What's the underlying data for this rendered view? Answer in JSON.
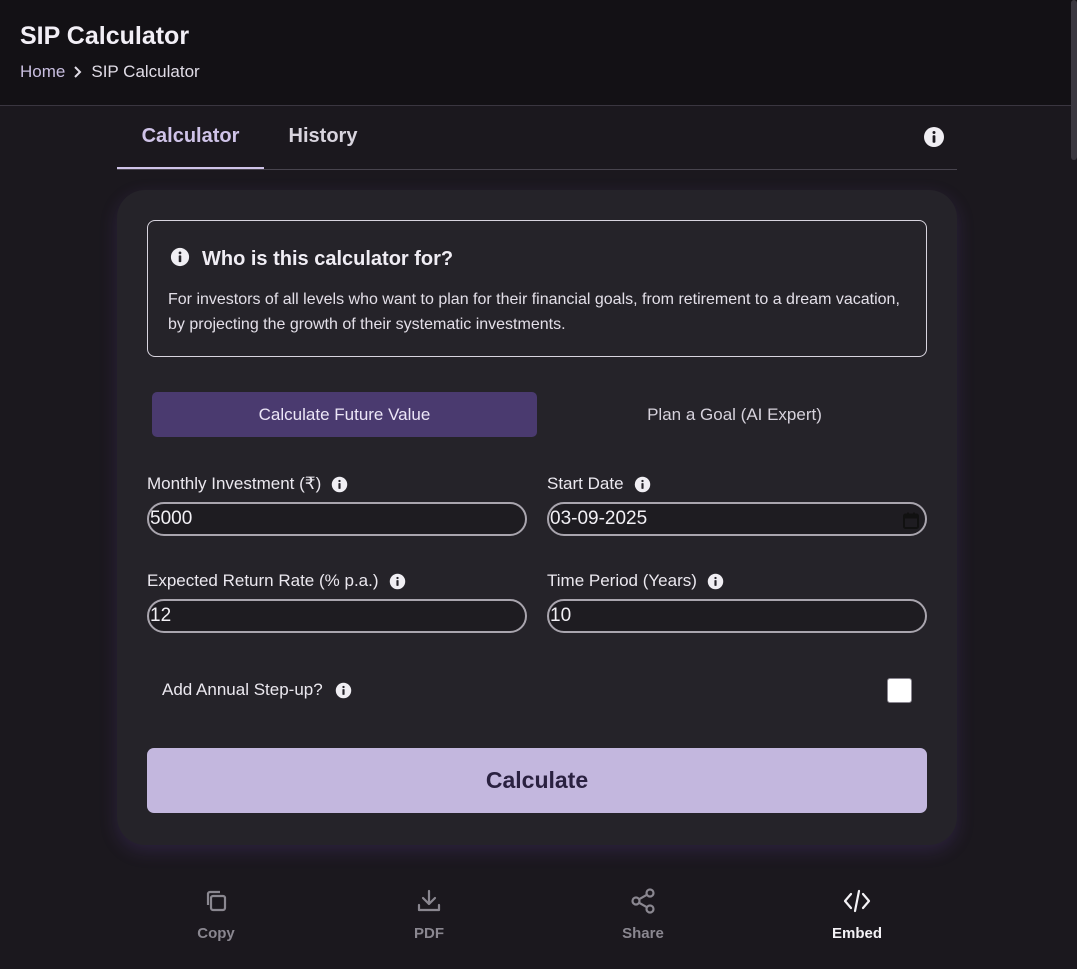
{
  "header": {
    "title": "SIP Calculator",
    "breadcrumb": {
      "home": "Home",
      "current": "SIP Calculator"
    }
  },
  "tabs": [
    {
      "label": "Calculator",
      "active": true
    },
    {
      "label": "History",
      "active": false
    }
  ],
  "info_box": {
    "title": "Who is this calculator for?",
    "text": "For investors of all levels who want to plan for their financial goals, from retirement to a dream vacation, by projecting the growth of their systematic investments."
  },
  "modes": {
    "active": "Calculate Future Value",
    "inactive": "Plan a Goal (AI Expert)"
  },
  "fields": {
    "monthly_investment": {
      "label": "Monthly Investment (₹)",
      "value": "5000"
    },
    "start_date": {
      "label": "Start Date",
      "value": "03-09-2025"
    },
    "return_rate": {
      "label": "Expected Return Rate (% p.a.)",
      "value": "12"
    },
    "time_period": {
      "label": "Time Period (Years)",
      "value": "10"
    }
  },
  "stepup": {
    "label": "Add Annual Step-up?",
    "checked": false
  },
  "calculate_label": "Calculate",
  "actions": [
    {
      "label": "Copy",
      "icon": "copy-icon"
    },
    {
      "label": "PDF",
      "icon": "download-icon"
    },
    {
      "label": "Share",
      "icon": "share-icon"
    },
    {
      "label": "Embed",
      "icon": "code-icon"
    }
  ],
  "colors": {
    "background": "#1b181e",
    "card": "#252329",
    "accent": "#c3b7de",
    "active_mode": "#4a3a6f"
  }
}
